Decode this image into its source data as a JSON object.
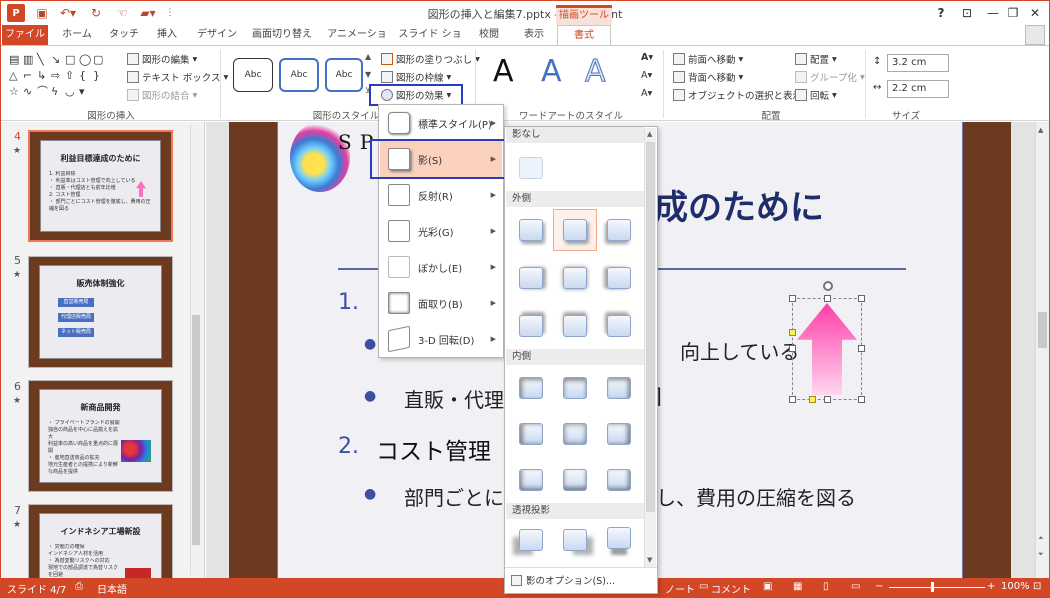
{
  "window": {
    "title": "図形の挿入と編集7.pptx - PowerPoint",
    "context_tab_group": "描画ツール",
    "buttons": {
      "help": "?",
      "ribbon_options": "⊡",
      "minimize": "—",
      "restore": "❐",
      "close": "✕"
    }
  },
  "tabs": [
    {
      "label": "ファイル"
    },
    {
      "label": "ホーム"
    },
    {
      "label": "タッチ"
    },
    {
      "label": "挿入"
    },
    {
      "label": "デザイン"
    },
    {
      "label": "画面切り替え"
    },
    {
      "label": "アニメーション"
    },
    {
      "label": "スライド ショー"
    },
    {
      "label": "校閲"
    },
    {
      "label": "表示"
    },
    {
      "label": "書式"
    }
  ],
  "active_tab": "書式",
  "ribbon": {
    "insert_shapes": {
      "label": "図形の挿入",
      "edit_shape": "図形の編集",
      "text_box": "テキスト ボックス",
      "merge_shapes": "図形の結合"
    },
    "shape_styles": {
      "label": "図形のスタイル",
      "fill": "図形の塗りつぶし",
      "outline": "図形の枠線",
      "effects": "図形の効果",
      "samples": [
        "Abc",
        "Abc",
        "Abc"
      ]
    },
    "wordart": {
      "label": "ワードアートのスタイル",
      "sample": "A"
    },
    "arrange": {
      "label": "配置",
      "bring_forward": "前面へ移動",
      "send_backward": "背面へ移動",
      "selection_pane": "オブジェクトの選択と表示",
      "align": "配置",
      "group": "グループ化",
      "rotate": "回転"
    },
    "size": {
      "label": "サイズ",
      "height": "3.2 cm",
      "width": "2.2 cm"
    }
  },
  "effects_menu": {
    "items": [
      {
        "label": "標準スタイル(P)"
      },
      {
        "label": "影(S)"
      },
      {
        "label": "反射(R)"
      },
      {
        "label": "光彩(G)"
      },
      {
        "label": "ぼかし(E)"
      },
      {
        "label": "面取り(B)"
      },
      {
        "label": "3-D 回転(D)"
      }
    ],
    "highlighted": "影(S)"
  },
  "shadow_submenu": {
    "sections": {
      "none": "影なし",
      "outer": "外側",
      "inner": "内側",
      "perspective": "透視投影"
    },
    "options": "影のオプション(S)..."
  },
  "slides": [
    {
      "number": "4",
      "title": "利益目標達成のために",
      "body": "1. 利益目標\n  ・ 利益率はコスト管理で向上している\n  ・ 直販・代理店とも前年比増\n2. コスト管理\n  ・ 部門ごとにコスト管理を徹底し、費用の圧縮を図る"
    },
    {
      "number": "5",
      "title": "販売体制強化",
      "tags": [
        "直営販売局",
        "代理店販売局",
        "ネット販売局"
      ]
    },
    {
      "number": "6",
      "title": "新商品開発",
      "body": "・ プライベートブランドの展開\n  独自の商品を中心に品揃えを拡大\n  利益率の高い商品を重点的に展開\n・ 産地直送商品の拡充\n  地元生産者との提携により新鮮な商品を提供"
    },
    {
      "number": "7",
      "title": "インドネシア工場新設",
      "body": "・ 労働力の確保\n  インドネシア人材を活用\n・ 為替変動リスクへの対応\n  現地での部品調達で為替リスクを回避"
    }
  ],
  "slide_main": {
    "logo_text": "SPAN",
    "title_fragment": "成のために",
    "item1_number": "1.",
    "bullet1_fragment": "向上している",
    "bullet2_fragment": "直販・代理店",
    "bullet2_end": "]",
    "item2_number": "2.",
    "item2_text": "コスト管理",
    "bullet3_start": "部門ごとに",
    "bullet3_end": "し、費用の圧縮を図る"
  },
  "statusbar": {
    "slide": "スライド 4/7",
    "language": "日本語",
    "notes": "ノート",
    "comments": "コメント",
    "zoom": "100%"
  },
  "colors": {
    "accent": "#d24726",
    "highlight_box": "#2b3ac2",
    "menu_highlight": "#fbd0bd",
    "slide_title": "#1f2d6b",
    "list_number": "#3d4fa3",
    "arrow": "#ff5fb8"
  }
}
